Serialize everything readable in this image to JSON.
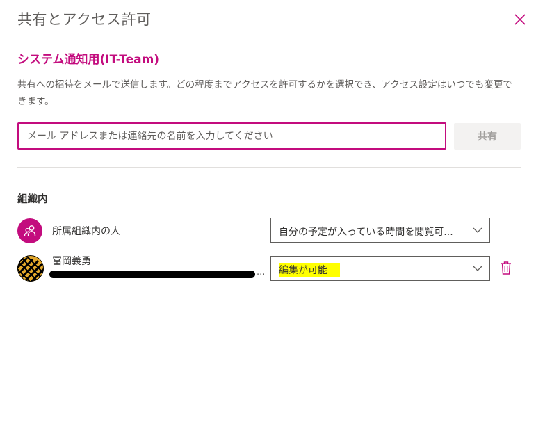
{
  "dialog": {
    "title": "共有とアクセス許可",
    "calendar_name": "システム通知用(IT-Team)",
    "description": "共有への招待をメールで送信します。どの程度までアクセスを許可するかを選択でき、アクセス設定はいつでも変更できます。",
    "input_placeholder": "メール アドレスまたは連絡先の名前を入力してください",
    "input_value": "",
    "share_label": "共有",
    "section_heading": "組織内"
  },
  "rows": [
    {
      "name": "所属組織内の人",
      "permission": "自分の予定が入っている時間を閲覧可...",
      "avatar_icon": "people-icon"
    },
    {
      "name": "冨岡義勇",
      "email_redacted": true,
      "ellipsis": "...",
      "permission": "編集が可能",
      "permission_highlighted": true,
      "avatar_icon": "pattern-avatar"
    }
  ],
  "colors": {
    "accent": "#c30c7e",
    "highlight": "#ffff00",
    "share_button_bg": "#f3f2f1",
    "share_button_text": "#a19f9d"
  },
  "icons": [
    "close-icon",
    "people-icon",
    "chevron-down-icon",
    "trash-icon"
  ]
}
